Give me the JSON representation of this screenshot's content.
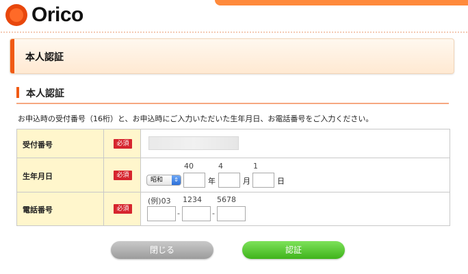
{
  "header": {
    "logo_text": "Orico"
  },
  "title_bar": {
    "title": "本人認証"
  },
  "section": {
    "heading": "本人認証",
    "instruction": "お申込時の受付番号（16桁）と、お申込時にご入力いただいた生年月日、お電話番号をご入力ください。"
  },
  "form": {
    "required_label": "必須",
    "receipt": {
      "label": "受付番号",
      "value": ""
    },
    "birthdate": {
      "label": "生年月日",
      "era_selected": "昭和",
      "hints": {
        "year": "40",
        "month": "4",
        "day": "1"
      },
      "units": {
        "year": "年",
        "month": "月",
        "day": "日"
      },
      "values": {
        "year": "",
        "month": "",
        "day": ""
      }
    },
    "phone": {
      "label": "電話番号",
      "hints": {
        "part1": "(例)03",
        "part2": "1234",
        "part3": "5678"
      },
      "separator": "-",
      "values": {
        "part1": "",
        "part2": "",
        "part3": ""
      }
    }
  },
  "buttons": {
    "close": "閉じる",
    "authenticate": "認証"
  },
  "colors": {
    "brand": "#f05a14",
    "required_badge": "#d6252e",
    "auth_button": "#3fb31b",
    "close_button": "#9c9c9c",
    "label_bg": "#fff6cc"
  },
  "icons": {
    "logo": "orico-logo-icon",
    "select_arrow": "chevron-updown-icon"
  }
}
